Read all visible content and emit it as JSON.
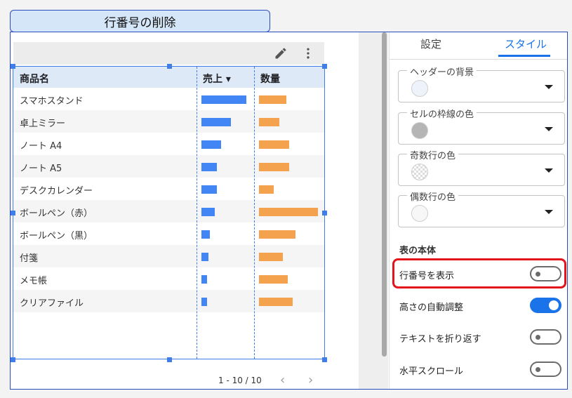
{
  "title_tab": {
    "label": "行番号の削除"
  },
  "table": {
    "headers": {
      "name": "商品名",
      "sales": "売上 ▾",
      "qty": "数量"
    },
    "rows": [
      {
        "name": "スマホスタンド",
        "sales": 1.0,
        "qty": 0.47
      },
      {
        "name": "卓上ミラー",
        "sales": 0.66,
        "qty": 0.35
      },
      {
        "name": "ノート A4",
        "sales": 0.43,
        "qty": 0.51
      },
      {
        "name": "ノート A5",
        "sales": 0.35,
        "qty": 0.51
      },
      {
        "name": "デスクカレンダー",
        "sales": 0.35,
        "qty": 0.25
      },
      {
        "name": "ボールペン（赤）",
        "sales": 0.29,
        "qty": 1.0
      },
      {
        "name": "ボールペン（黒）",
        "sales": 0.19,
        "qty": 0.62
      },
      {
        "name": "付箋",
        "sales": 0.15,
        "qty": 0.41
      },
      {
        "name": "メモ帳",
        "sales": 0.13,
        "qty": 0.49
      },
      {
        "name": "クリアファイル",
        "sales": 0.13,
        "qty": 0.57
      }
    ],
    "pager": {
      "text": "1 - 10 / 10",
      "prev": "‹",
      "next": "›"
    },
    "toolbar": {
      "edit_icon": "pencil-icon",
      "more_icon": "more-vert-icon"
    }
  },
  "panel": {
    "tabs": {
      "settings": "設定",
      "style": "スタイル"
    },
    "colors": {
      "header_bg": {
        "label": "ヘッダーの背景",
        "color": "#eef2fb"
      },
      "border": {
        "label": "セルの枠線の色",
        "color": "#b5b5b5"
      },
      "odd_row": {
        "label": "奇数行の色",
        "color": "checker"
      },
      "even_row": {
        "label": "偶数行の色",
        "color": "#f7f7f7"
      }
    },
    "section_title": "表の本体",
    "options": [
      {
        "label": "行番号を表示",
        "on": false
      },
      {
        "label": "高さの自動調整",
        "on": true
      },
      {
        "label": "テキストを折り返す",
        "on": false
      },
      {
        "label": "水平スクロール",
        "on": false
      }
    ]
  },
  "accent_colors": {
    "blue": "#4285f4",
    "orange": "#f4a24e",
    "highlight": "#e4141c"
  }
}
